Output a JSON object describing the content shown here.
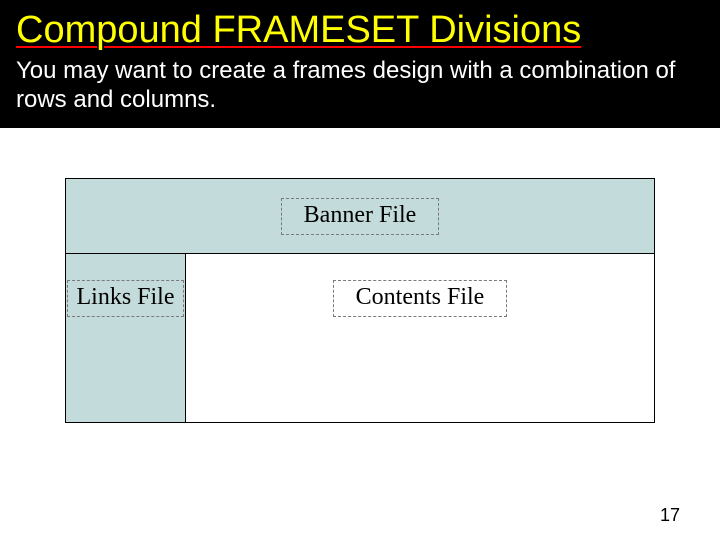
{
  "header": {
    "title": "Compound FRAMESET Divisions",
    "subtitle": "You may want to create a frames design with a combination of rows and columns."
  },
  "diagram": {
    "banner_label": "Banner File",
    "links_label": "Links File",
    "contents_label": "Contents File"
  },
  "page_number": "17"
}
